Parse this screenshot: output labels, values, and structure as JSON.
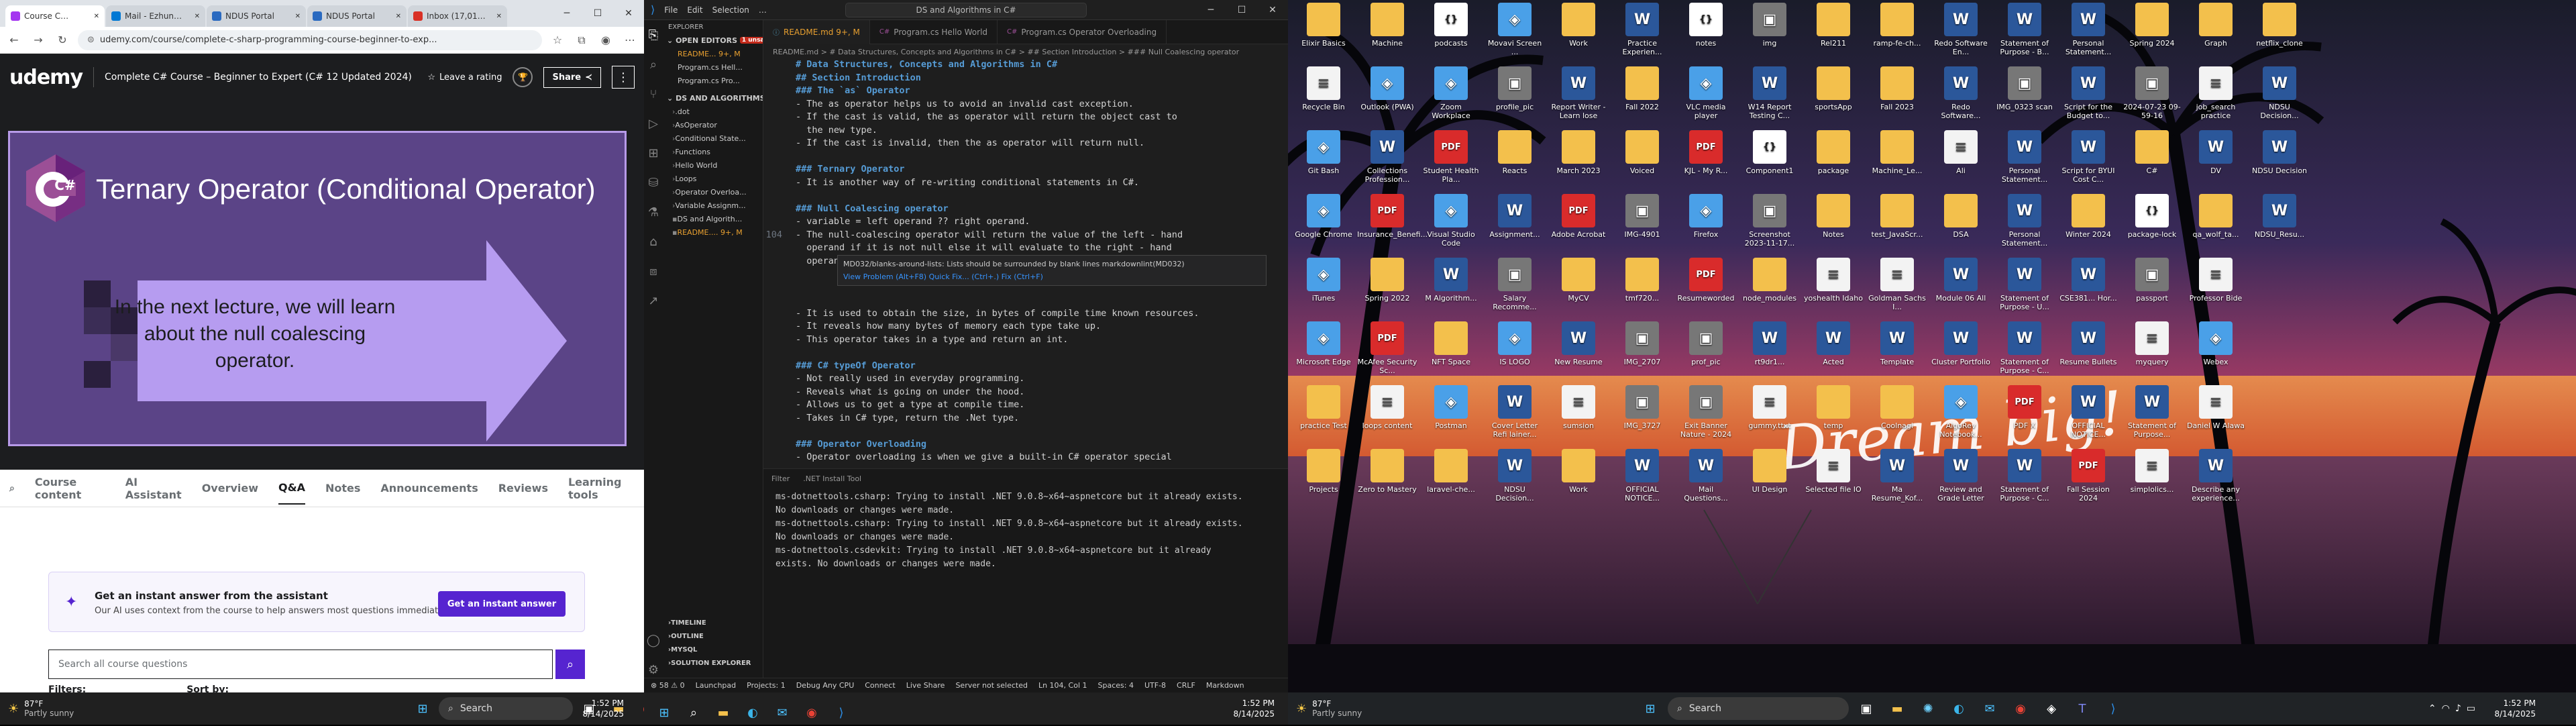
{
  "browser": {
    "tabs": [
      {
        "label": "Course C…",
        "active": true,
        "color": "#a435f0"
      },
      {
        "label": "Mail - Ezhun…",
        "active": false,
        "color": "#0078d4"
      },
      {
        "label": "NDUS Portal",
        "active": false,
        "color": "#2a6ac0"
      },
      {
        "label": "NDUS Portal",
        "active": false,
        "color": "#2a6ac0"
      },
      {
        "label": "Inbox (17,01…",
        "active": false,
        "color": "#d93025"
      }
    ],
    "url": "udemy.com/course/complete-c-sharp-programming-course-beginner-to-exp...",
    "brand": "udemy",
    "course_title": "Complete C# Course – Beginner to Expert (C# 12 Updated 2024)",
    "rating_label": "Leave a rating",
    "share_label": "Share",
    "slide": {
      "title": "Ternary Operator (Conditional Operator)",
      "body": "In the next lecture, we will learn about the null coalescing operator.",
      "logo": "C#"
    },
    "course_nav": [
      "Course content",
      "AI Assistant",
      "Overview",
      "Q&A",
      "Notes",
      "Announcements",
      "Reviews",
      "Learning tools"
    ],
    "active_nav": "Q&A",
    "ai_box": {
      "title": "Get an instant answer from the assistant",
      "subtitle": "Our AI uses context from the course to help answers most questions immediately.",
      "button": "Get an instant answer"
    },
    "search_placeholder": "Search all course questions",
    "filters_label": "Filters:",
    "sort_label": "Sort by:"
  },
  "taskbar_left": {
    "temp": "87°F",
    "condition": "Partly sunny",
    "search": "Search",
    "time": "1:52 PM",
    "date": "8/14/2025"
  },
  "editor": {
    "menu": [
      "File",
      "Edit",
      "Selection",
      "…"
    ],
    "window_title": "DS and Algorithms in C#",
    "open_editors_label": "OPEN EDITORS",
    "open_editors_badge": "1 unsaved",
    "open_files": [
      "README...  9+, M",
      "Program.cs  Hell...",
      "Program.cs  Pro..."
    ],
    "workspace_label": "DS AND ALGORITHMS IN C#",
    "tree": [
      ".dot",
      "AsOperator",
      "Conditional State...",
      "Functions",
      "Hello World",
      "Loops",
      "Operator Overloa...",
      "Variable Assignm...",
      "DS and Algorith...",
      "README....  9+, M"
    ],
    "tabs": [
      "README.md  9+, M",
      "Program.cs  Hello World",
      "Program.cs  Operator Overloading"
    ],
    "breadcrumbs": "README.md > # Data Structures, Concepts and Algorithms in C# > ## Section Introduction > ### Null Coalescing operator",
    "code": [
      {
        "n": "",
        "t": "# Data Structures, Concepts and Algorithms in C#",
        "k": "h"
      },
      {
        "n": "",
        "t": "## Section Introduction",
        "k": "h"
      },
      {
        "n": "",
        "t": "### The `as` Operator",
        "k": "h"
      },
      {
        "n": "",
        "t": "- The as operator helps us to avoid an invalid cast exception.",
        "k": ""
      },
      {
        "n": "",
        "t": "- If the cast is valid, the as operator will return the object cast to",
        "k": ""
      },
      {
        "n": "",
        "t": "  the new type.",
        "k": ""
      },
      {
        "n": "",
        "t": "- If the cast is invalid, then the as operator will return null.",
        "k": ""
      },
      {
        "n": "",
        "t": "",
        "k": ""
      },
      {
        "n": "",
        "t": "### Ternary Operator",
        "k": "h"
      },
      {
        "n": "",
        "t": "- It is another way of re-writing conditional statements in C#.",
        "k": ""
      },
      {
        "n": "",
        "t": "",
        "k": ""
      },
      {
        "n": "",
        "t": "### Null Coalescing operator",
        "k": "h"
      },
      {
        "n": "",
        "t": "- variable = left operand ?? right operand.",
        "k": ""
      },
      {
        "n": "104",
        "t": "- The null-coalescing operator will return the value of the left - hand",
        "k": ""
      },
      {
        "n": "",
        "t": "  operand if it is not null else it will evaluate to the right - hand",
        "k": ""
      },
      {
        "n": "",
        "t": "  operand and return the result.",
        "k": ""
      },
      {
        "n": "",
        "t": "",
        "k": ""
      },
      {
        "n": "",
        "t": "",
        "k": ""
      },
      {
        "n": "",
        "t": "",
        "k": ""
      },
      {
        "n": "",
        "t": "- It is used to obtain the size, in bytes of compile time known resources.",
        "k": ""
      },
      {
        "n": "",
        "t": "- It reveals how many bytes of memory each type take up.",
        "k": ""
      },
      {
        "n": "",
        "t": "- This operator takes in a type and return an int.",
        "k": ""
      },
      {
        "n": "",
        "t": "",
        "k": ""
      },
      {
        "n": "",
        "t": "### C# typeOf Operator",
        "k": "h"
      },
      {
        "n": "",
        "t": "- Not really used in everyday programming.",
        "k": ""
      },
      {
        "n": "",
        "t": "- Reveals what is going on under the hood.",
        "k": ""
      },
      {
        "n": "",
        "t": "- Allows us to get a type at compile time.",
        "k": ""
      },
      {
        "n": "",
        "t": "- Takes in C# type, return the .Net type.",
        "k": ""
      },
      {
        "n": "",
        "t": "",
        "k": ""
      },
      {
        "n": "",
        "t": "### Operator Overloading",
        "k": "h"
      },
      {
        "n": "",
        "t": "- Operator overloading is when we give a built-in C# operator special",
        "k": ""
      }
    ],
    "hint": {
      "line1": "MD032/blanks-around-lists: Lists should be surrounded by blank lines markdownlint(MD032)",
      "actions": "View Problem (Alt+F8)   Quick Fix... (Ctrl+.)   Fix (Ctrl+F)"
    },
    "panel_tabs": [
      "Filter",
      ".NET Install Tool"
    ],
    "panel_lines": [
      "ms-dotnettools.csharp: Trying to install .NET 9.0.8~x64~aspnetcore but it already exists.",
      "No downloads or changes were made.",
      "ms-dotnettools.csharp: Trying to install .NET 9.0.8~x64~aspnetcore but it already exists.",
      "No downloads or changes were made.",
      "ms-dotnettools.csdevkit: Trying to install .NET 9.0.8~x64~aspnetcore but it already",
      "exists. No downloads or changes were made."
    ],
    "outline": [
      "TIMELINE",
      "OUTLINE",
      "MYSQL",
      "SOLUTION EXPLORER"
    ],
    "status": [
      "⊗ 58  ⚠ 0",
      "Launchpad",
      "Projects: 1",
      "Debug Any CPU",
      "Connect",
      "Live Share",
      "Server not selected",
      "Ln 104, Col 1",
      "Spaces: 4",
      "UTF-8",
      "CRLF",
      "Markdown"
    ]
  },
  "desktop": {
    "icons": [
      {
        "n": "Elixir Basics",
        "t": "folder"
      },
      {
        "n": "Machine",
        "t": "folder"
      },
      {
        "n": "podcasts",
        "t": "js"
      },
      {
        "n": "Movavi Screen ...",
        "t": "app"
      },
      {
        "n": "Work",
        "t": "folder"
      },
      {
        "n": "Practice Experien...",
        "t": "word"
      },
      {
        "n": "notes",
        "t": "js"
      },
      {
        "n": "img",
        "t": "img"
      },
      {
        "n": "Rel211",
        "t": "folder"
      },
      {
        "n": "ramp-fe-ch...",
        "t": "folder"
      },
      {
        "n": "Redo Software En...",
        "t": "word"
      },
      {
        "n": "Statement of Purpose - B...",
        "t": "word"
      },
      {
        "n": "Personal Statement...",
        "t": "word"
      },
      {
        "n": "Spring 2024",
        "t": "folder"
      },
      {
        "n": "Graph",
        "t": "folder"
      },
      {
        "n": "netflix_clone",
        "t": "folder"
      },
      {
        "n": "Recycle Bin",
        "t": "file"
      },
      {
        "n": "Outlook (PWA)",
        "t": "app"
      },
      {
        "n": "Zoom Workplace",
        "t": "app"
      },
      {
        "n": "profile_pic",
        "t": "img"
      },
      {
        "n": "Report Writer - Learn lose",
        "t": "word"
      },
      {
        "n": "Fall 2022",
        "t": "folder"
      },
      {
        "n": "VLC media player",
        "t": "app"
      },
      {
        "n": "W14 Report Testing C...",
        "t": "word"
      },
      {
        "n": "sportsApp",
        "t": "folder"
      },
      {
        "n": "Fall 2023",
        "t": "folder"
      },
      {
        "n": "Redo Software...",
        "t": "word"
      },
      {
        "n": "IMG_0323 scan",
        "t": "img"
      },
      {
        "n": "Script for the Budget to...",
        "t": "word"
      },
      {
        "n": "2024-07-23 09-59-16",
        "t": "img"
      },
      {
        "n": "job_search practice",
        "t": "file"
      },
      {
        "n": "NDSU Decision...",
        "t": "word"
      },
      {
        "n": "Git Bash",
        "t": "app"
      },
      {
        "n": "Collections Profession...",
        "t": "word"
      },
      {
        "n": "Student Health Pla...",
        "t": "pdf"
      },
      {
        "n": "Reacts",
        "t": "folder"
      },
      {
        "n": "March 2023",
        "t": "folder"
      },
      {
        "n": "Voiced",
        "t": "folder"
      },
      {
        "n": "KJL - My R...",
        "t": "pdf"
      },
      {
        "n": "Component1",
        "t": "js"
      },
      {
        "n": "package",
        "t": "folder"
      },
      {
        "n": "Machine_Le...",
        "t": "folder"
      },
      {
        "n": "Ali",
        "t": "file"
      },
      {
        "n": "Personal Statement...",
        "t": "word"
      },
      {
        "n": "Script for BYUI Cost C...",
        "t": "word"
      },
      {
        "n": "C#",
        "t": "folder"
      },
      {
        "n": "DV",
        "t": "word"
      },
      {
        "n": "NDSU Decision",
        "t": "word"
      },
      {
        "n": "Google Chrome",
        "t": "app"
      },
      {
        "n": "Insurance_Benefi...",
        "t": "pdf"
      },
      {
        "n": "Visual Studio Code",
        "t": "app"
      },
      {
        "n": "Assignment...",
        "t": "word"
      },
      {
        "n": "Adobe Acrobat",
        "t": "pdf"
      },
      {
        "n": "IMG-4901",
        "t": "img"
      },
      {
        "n": "Firefox",
        "t": "app"
      },
      {
        "n": "Screenshot 2023-11-17...",
        "t": "img"
      },
      {
        "n": "Notes",
        "t": "folder"
      },
      {
        "n": "test_JavaScr...",
        "t": "folder"
      },
      {
        "n": "DSA",
        "t": "folder"
      },
      {
        "n": "Personal Statement...",
        "t": "word"
      },
      {
        "n": "Winter 2024",
        "t": "folder"
      },
      {
        "n": "package-lock",
        "t": "js"
      },
      {
        "n": "qa_wolf_ta...",
        "t": "folder"
      },
      {
        "n": "NDSU_Resu...",
        "t": "word"
      },
      {
        "n": "iTunes",
        "t": "app"
      },
      {
        "n": "Spring 2022",
        "t": "folder"
      },
      {
        "n": "M Algorithm...",
        "t": "word"
      },
      {
        "n": "Salary Recomme...",
        "t": "img"
      },
      {
        "n": "MyCV",
        "t": "folder"
      },
      {
        "n": "tmf720...",
        "t": "folder"
      },
      {
        "n": "Resumeworded",
        "t": "pdf"
      },
      {
        "n": "node_modules",
        "t": "folder"
      },
      {
        "n": "yoshealth Idaho",
        "t": "file"
      },
      {
        "n": "Goldman Sachs I...",
        "t": "file"
      },
      {
        "n": "Module 06 All",
        "t": "word"
      },
      {
        "n": "Statement of Purpose - U...",
        "t": "word"
      },
      {
        "n": "CSE381... Hor...",
        "t": "word"
      },
      {
        "n": "passport",
        "t": "img"
      },
      {
        "n": "Professor Bide",
        "t": "file"
      },
      {
        "n": "Microsoft Edge",
        "t": "app"
      },
      {
        "n": "McAfee Security Sc...",
        "t": "pdf"
      },
      {
        "n": "NFT Space",
        "t": "folder"
      },
      {
        "n": "IS LOGO",
        "t": "app"
      },
      {
        "n": "New Resume",
        "t": "word"
      },
      {
        "n": "IMG_2707",
        "t": "img"
      },
      {
        "n": "prof_pic",
        "t": "img"
      },
      {
        "n": "rt9dr1...",
        "t": "word"
      },
      {
        "n": "Acted",
        "t": "word"
      },
      {
        "n": "Template",
        "t": "word"
      },
      {
        "n": "Cluster Portfolio",
        "t": "word"
      },
      {
        "n": "Statement of Purpose - C...",
        "t": "word"
      },
      {
        "n": "Resume Bullets",
        "t": "word"
      },
      {
        "n": "myquery",
        "t": "file"
      },
      {
        "n": "Webex",
        "t": "app"
      },
      {
        "n": "practice Test",
        "t": "folder"
      },
      {
        "n": "loops content",
        "t": "file"
      },
      {
        "n": "Postman",
        "t": "app"
      },
      {
        "n": "Cover Letter Refi lainer...",
        "t": "word"
      },
      {
        "n": "sumsion",
        "t": "file"
      },
      {
        "n": "IMG_3727",
        "t": "img"
      },
      {
        "n": "Exit Banner Nature - 2024",
        "t": "img"
      },
      {
        "n": "gummy.ttxt",
        "t": "file"
      },
      {
        "n": "temp",
        "t": "folder"
      },
      {
        "n": "Coolnagi",
        "t": "folder"
      },
      {
        "n": "AlgoRev Notebook...",
        "t": "app"
      },
      {
        "n": "PDF X",
        "t": "pdf"
      },
      {
        "n": "OFFICIAL NOTICE...",
        "t": "word"
      },
      {
        "n": "Statement of Purpose...",
        "t": "word"
      },
      {
        "n": "Daniel W Alawa",
        "t": "file"
      },
      {
        "n": "Projects",
        "t": "folder"
      },
      {
        "n": "Zero to Mastery",
        "t": "folder"
      },
      {
        "n": "laravel-che...",
        "t": "folder"
      },
      {
        "n": "NDSU Decision...",
        "t": "word"
      },
      {
        "n": "Work",
        "t": "folder"
      },
      {
        "n": "OFFICIAL NOTICE...",
        "t": "word"
      },
      {
        "n": "Mail Questions...",
        "t": "word"
      },
      {
        "n": "UI Design",
        "t": "folder"
      },
      {
        "n": "Selected file IO",
        "t": "file"
      },
      {
        "n": "Ma Resume_Kof...",
        "t": "word"
      },
      {
        "n": "Review and Grade Letter",
        "t": "word"
      },
      {
        "n": "Statement of Purpose - C...",
        "t": "word"
      },
      {
        "n": "Fall Session 2024",
        "t": "pdf"
      },
      {
        "n": "simplolics...",
        "t": "file"
      },
      {
        "n": "Describe any experience...",
        "t": "word"
      }
    ],
    "wallpaper_text": "Dream big!"
  },
  "taskbar_right": {
    "temp": "87°F",
    "condition": "Partly sunny",
    "search": "Search",
    "time": "1:52 PM",
    "date": "8/14/2025"
  }
}
